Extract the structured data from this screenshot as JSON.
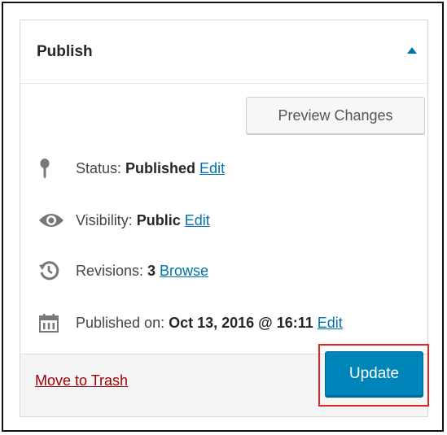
{
  "publish_box": {
    "title": "Publish",
    "toggle_icon": "triangle-up-icon"
  },
  "preview_button_label": "Preview Changes",
  "status": {
    "icon": "pin-icon",
    "label": "Status:",
    "value": "Published",
    "link": "Edit"
  },
  "visibility": {
    "icon": "eye-icon",
    "label": "Visibility:",
    "value": "Public",
    "link": "Edit"
  },
  "revisions": {
    "icon": "history-icon",
    "label": "Revisions:",
    "value": "3",
    "link": "Browse"
  },
  "published_on": {
    "icon": "calendar-icon",
    "label": "Published on:",
    "value": "Oct 13, 2016 @ 16:11",
    "link": "Edit"
  },
  "footer": {
    "trash_label": "Move to Trash",
    "update_label": "Update"
  },
  "colors": {
    "primary_button": "#0085ba",
    "link": "#0073aa",
    "trash_link": "#a00000",
    "highlight_box": "#e0262b"
  }
}
